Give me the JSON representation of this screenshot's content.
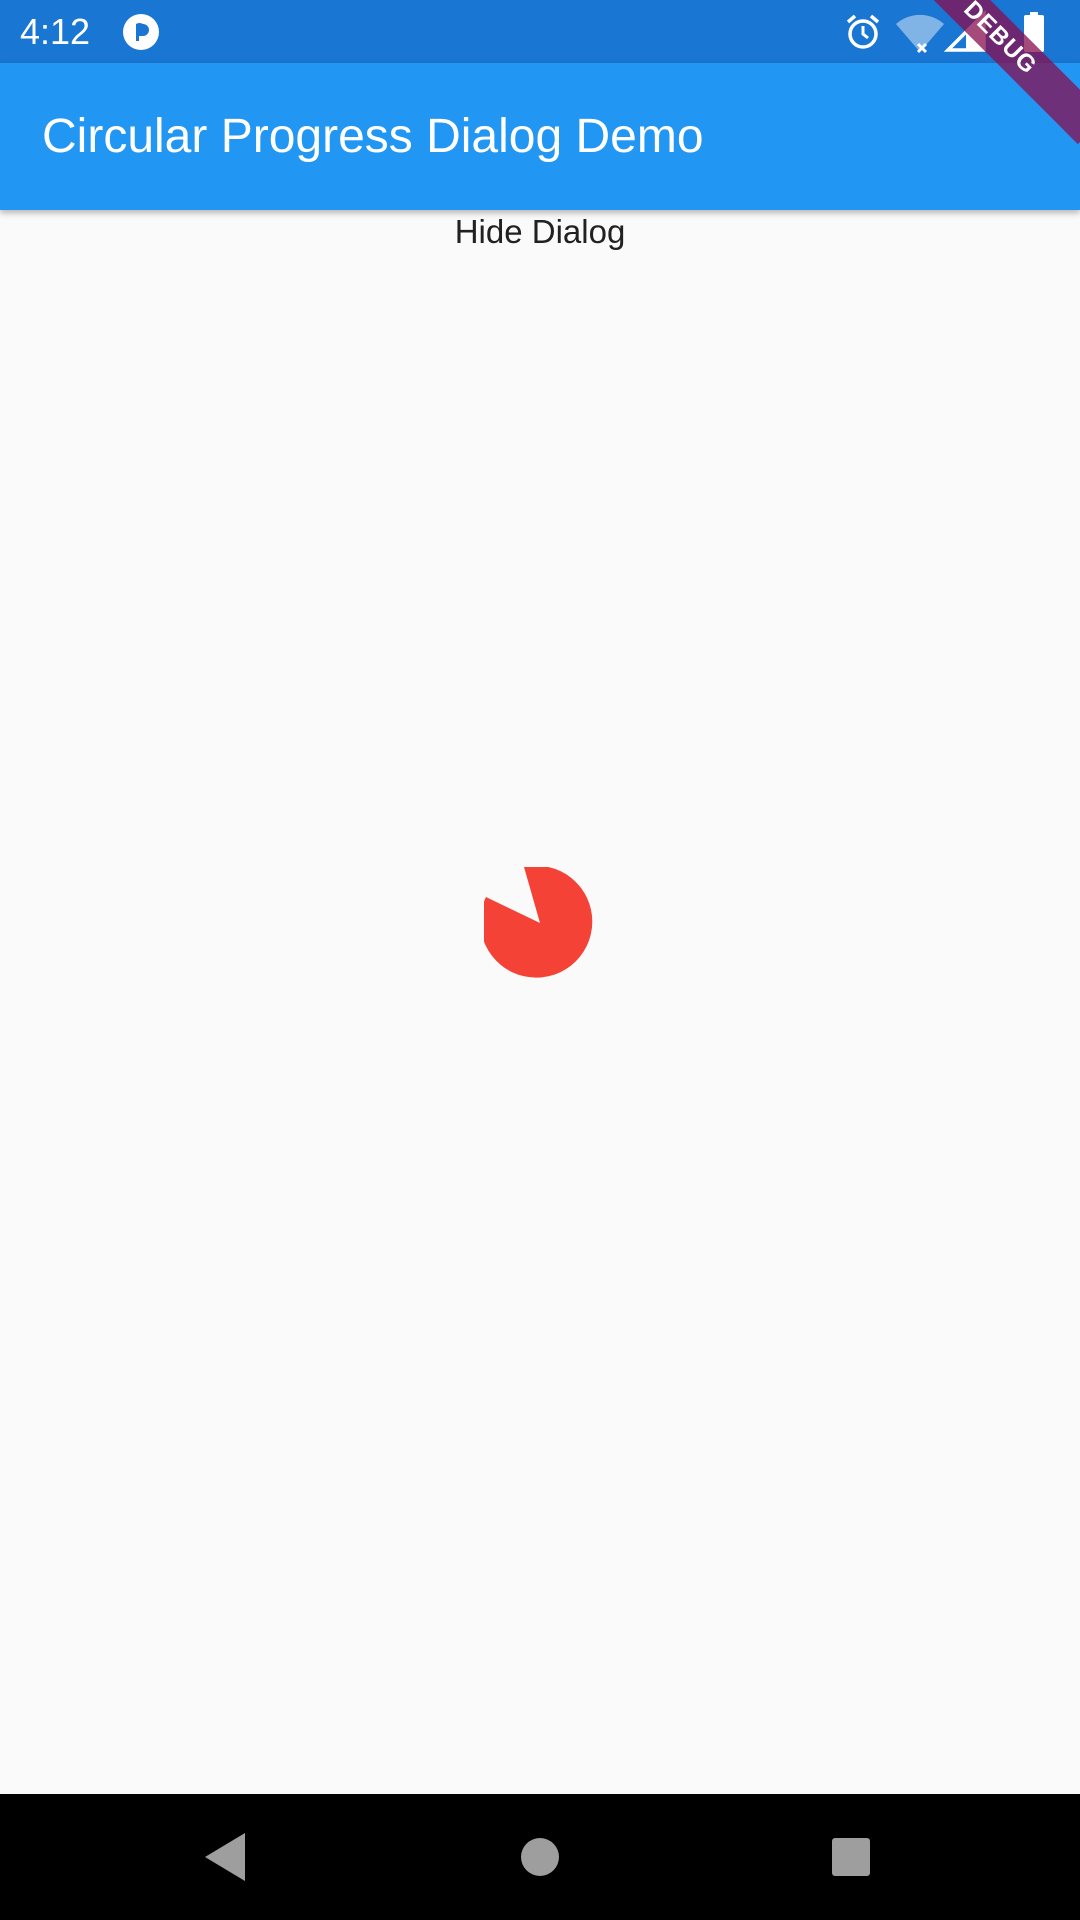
{
  "status_bar": {
    "time": "4:12",
    "icons": [
      "app-notification-icon",
      "alarm-icon",
      "wifi-off-icon",
      "signal-icon",
      "battery-icon"
    ],
    "color": "#1976D2"
  },
  "app_bar": {
    "title": "Circular Progress Dialog Demo",
    "color": "#2196F3"
  },
  "debug_banner": {
    "label": "DEBUG",
    "color": "#880E4F"
  },
  "content": {
    "hide_dialog_label": "Hide Dialog"
  },
  "progress": {
    "type": "circular-indeterminate",
    "color": "#F44336"
  },
  "nav_bar": {
    "buttons": [
      "back-icon",
      "home-icon",
      "recents-icon"
    ],
    "color": "#000000"
  }
}
